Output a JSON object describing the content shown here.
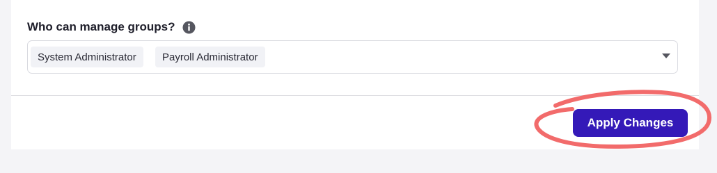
{
  "settings": {
    "manage_groups_label": "Who can manage groups?",
    "info_icon": "info-circle-icon",
    "selected_roles": [
      {
        "label": "System Administrator"
      },
      {
        "label": "Payroll Administrator"
      }
    ],
    "dropdown_icon": "caret-down-icon"
  },
  "footer": {
    "apply_label": "Apply Changes"
  },
  "colors": {
    "primary_button": "#3419b8",
    "annotation_stroke": "#f26b6b",
    "chip_background": "#f1f2f6"
  }
}
